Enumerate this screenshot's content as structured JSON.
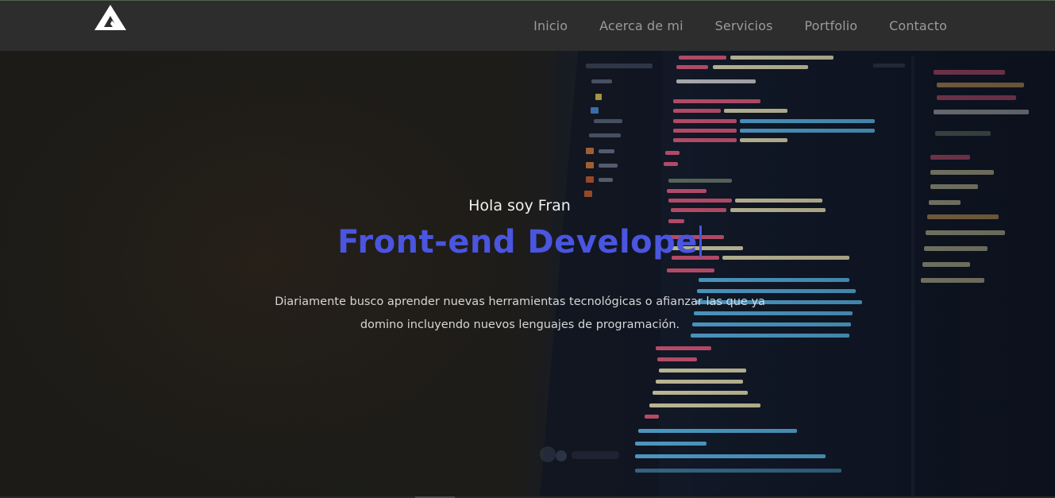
{
  "nav": {
    "links": [
      {
        "label": "Inicio"
      },
      {
        "label": "Acerca de mi"
      },
      {
        "label": "Servicios"
      },
      {
        "label": "Portfolio"
      },
      {
        "label": "Contacto"
      }
    ]
  },
  "logo": {
    "icon": "triangle-a-logo"
  },
  "hero": {
    "greeting": "Hola soy Fran",
    "title": "Front-end Develope",
    "description_line1": "Diariamente busco aprender nuevas herramientas tecnológicas o afianzar las que ya",
    "description_line2": "domino incluyendo nuevos lenguajes de programación."
  },
  "colors": {
    "navbar_bg": "#2d2d2d",
    "nav_link": "#9a9a9a",
    "accent": "#4a55e0",
    "text_light": "#f1f1f1"
  }
}
